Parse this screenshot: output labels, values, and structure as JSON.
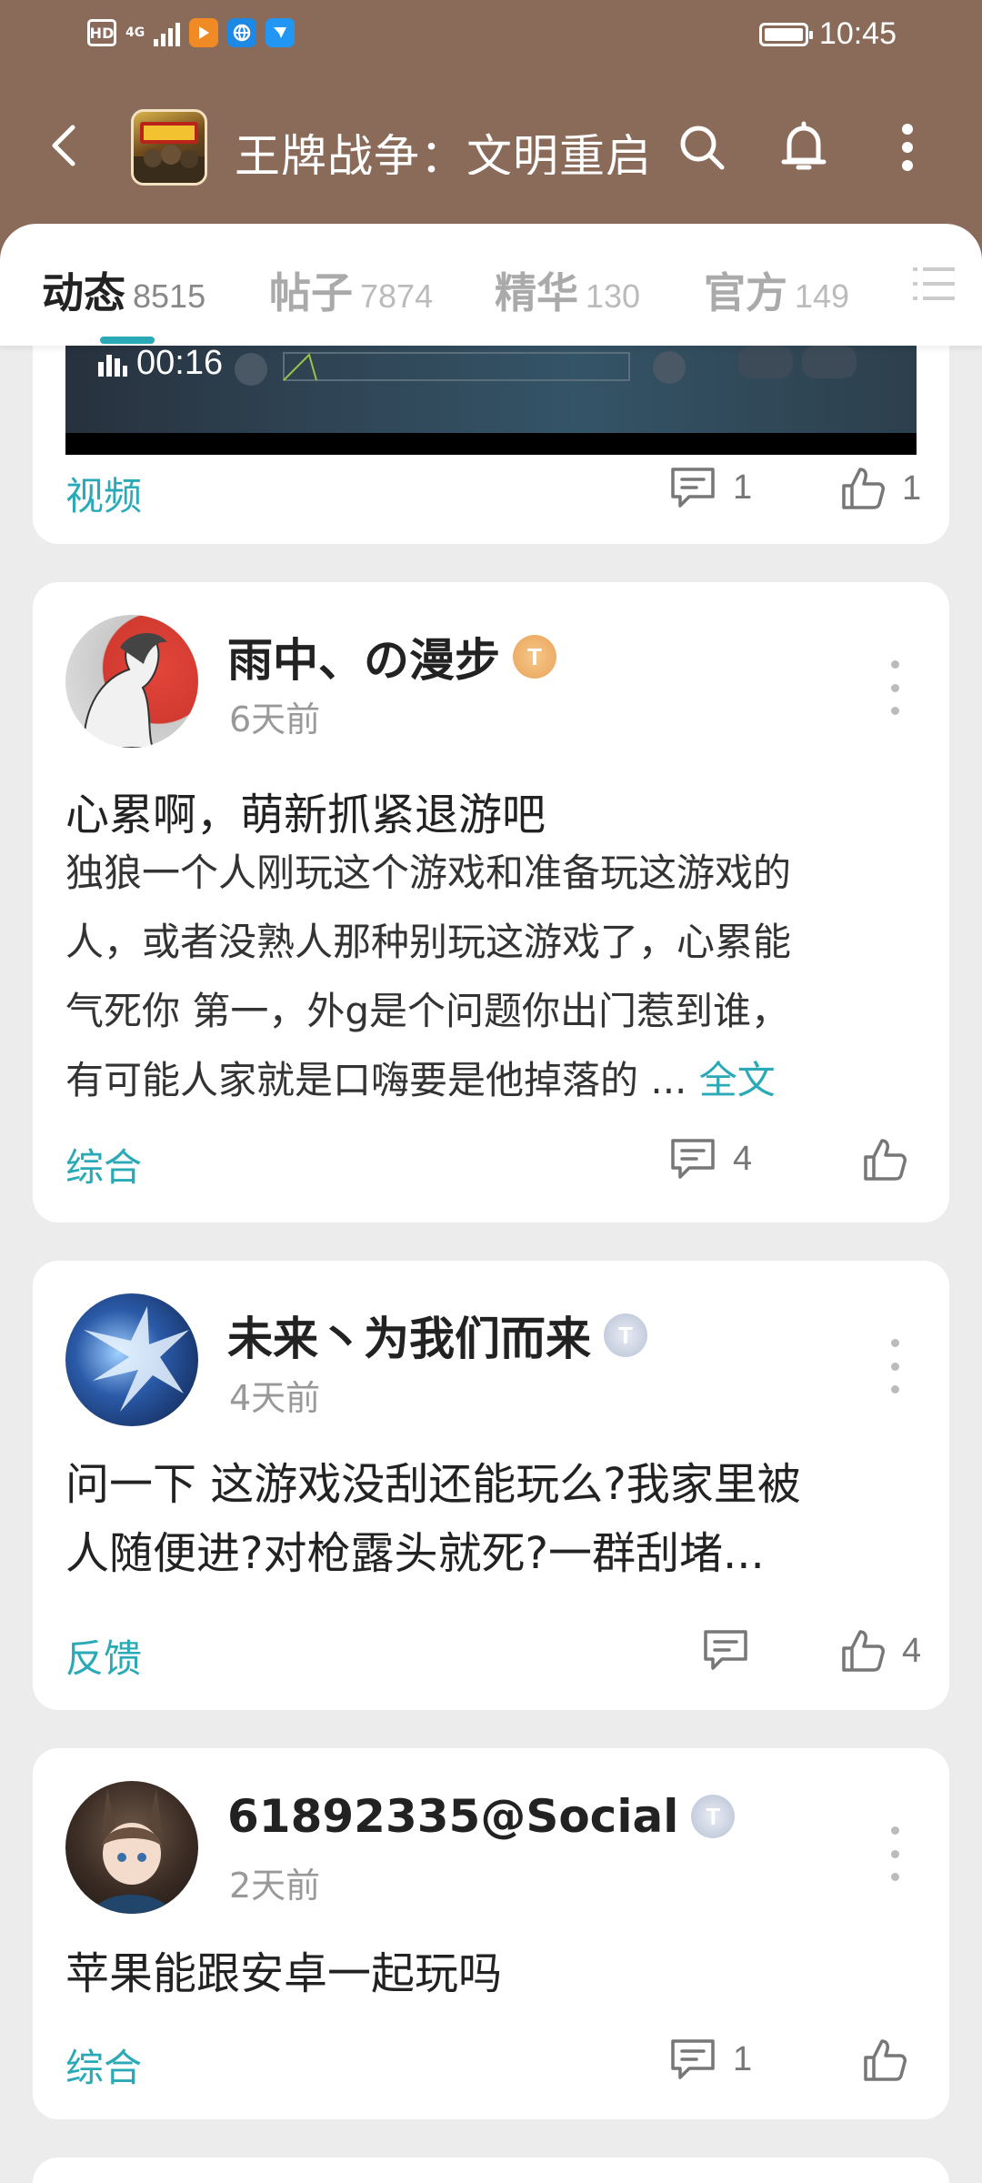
{
  "status": {
    "hd": "HD",
    "network": "4G",
    "time": "10:45"
  },
  "header": {
    "title": "王牌战争：文明重启"
  },
  "tabs": [
    {
      "label": "动态",
      "count": "8515",
      "active": true
    },
    {
      "label": "帖子",
      "count": "7874"
    },
    {
      "label": "精华",
      "count": "130"
    },
    {
      "label": "官方",
      "count": "149"
    }
  ],
  "video_post": {
    "duration": "00:16",
    "category": "视频",
    "comments": "1",
    "likes": "1"
  },
  "posts": [
    {
      "user": "雨中、の漫步",
      "badge": "T",
      "time": "6天前",
      "title": "心累啊，萌新抓紧退游吧",
      "body_lines": [
        "独狼一个人刚玩这个游戏和准备玩这游戏的",
        "人，或者没熟人那种别玩这游戏了，心累能",
        "气死你 第一，外g是个问题你出门惹到谁，",
        "有可能人家就是口嗨要是他掉落的 ..."
      ],
      "full_text": "全文",
      "category": "综合",
      "comments": "4",
      "likes": ""
    },
    {
      "user": "未来丶为我们而来",
      "badge": "T",
      "time": "4天前",
      "body_lines": [
        "问一下 这游戏没刮还能玩么?我家里被",
        "人随便进?对枪露头就死?一群刮堵..."
      ],
      "category": "反馈",
      "comments": "",
      "likes": "4"
    },
    {
      "user": "61892335@Social",
      "badge": "T",
      "time": "2天前",
      "body_lines": [
        "苹果能跟安卓一起玩吗"
      ],
      "category": "综合",
      "comments": "1",
      "likes": ""
    }
  ],
  "colors": {
    "header": "#8a6a58",
    "accent": "#2aa9b7",
    "background": "#ececec"
  }
}
